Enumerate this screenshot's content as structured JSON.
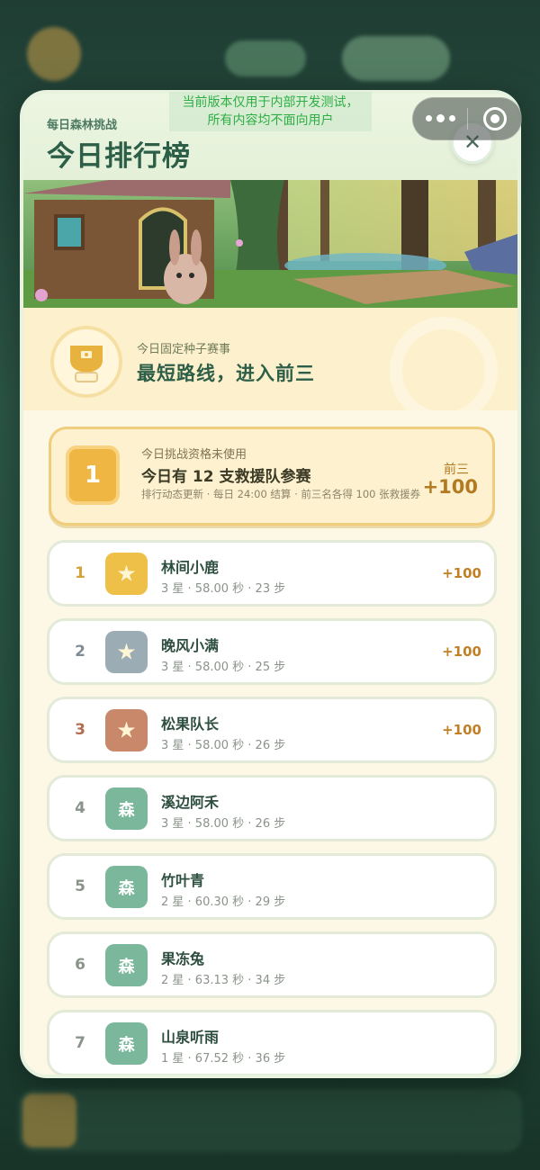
{
  "dev_notice": {
    "line1": "当前版本仅用于内部开发测试，",
    "line2": "所有内容均不面向用户"
  },
  "capsule": {
    "more_icon": "more-dots-icon",
    "close_icon": "target-circle-icon"
  },
  "header": {
    "subtitle": "每日森林挑战",
    "title": "今日排行榜",
    "close_symbol": "✕"
  },
  "seed": {
    "label": "今日固定种子赛事",
    "title": "最短路线，进入前三"
  },
  "challenge": {
    "badge": "1",
    "label": "今日挑战资格未使用",
    "title": "今日有 12 支救援队参赛",
    "note": "排行动态更新 · 每日 24:00 结算 · 前三名各得 100 张救援券",
    "reward_label": "前三",
    "reward": "+100"
  },
  "ranks": [
    {
      "rank": "1",
      "name": "林间小鹿",
      "stats": "3 星 · 58.00 秒 · 23 步",
      "reward": "+100",
      "avatar": "star",
      "color": "#efc048",
      "rank_color": "#d4a33a"
    },
    {
      "rank": "2",
      "name": "晚风小满",
      "stats": "3 星 · 58.00 秒 · 25 步",
      "reward": "+100",
      "avatar": "star",
      "color": "#9cacb5",
      "rank_color": "#7f8c95"
    },
    {
      "rank": "3",
      "name": "松果队长",
      "stats": "3 星 · 58.00 秒 · 26 步",
      "reward": "+100",
      "avatar": "star",
      "color": "#c9886a",
      "rank_color": "#b16e4f"
    },
    {
      "rank": "4",
      "name": "溪边阿禾",
      "stats": "3 星 · 58.00 秒 · 26 步",
      "reward": "",
      "avatar": "森",
      "color": "#7ab79b",
      "rank_color": "#8a938a"
    },
    {
      "rank": "5",
      "name": "竹叶青",
      "stats": "2 星 · 60.30 秒 · 29 步",
      "reward": "",
      "avatar": "森",
      "color": "#7ab79b",
      "rank_color": "#8a938a"
    },
    {
      "rank": "6",
      "name": "果冻兔",
      "stats": "2 星 · 63.13 秒 · 34 步",
      "reward": "",
      "avatar": "森",
      "color": "#7ab79b",
      "rank_color": "#8a938a"
    },
    {
      "rank": "7",
      "name": "山泉听雨",
      "stats": "1 星 · 67.52 秒 · 36 步",
      "reward": "",
      "avatar": "森",
      "color": "#7ab79b",
      "rank_color": "#8a938a"
    }
  ]
}
